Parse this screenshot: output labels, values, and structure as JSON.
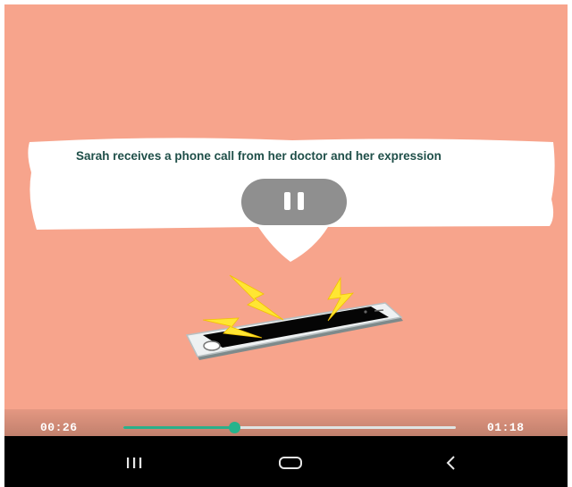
{
  "caption": {
    "text": "Sarah receives a phone call from her doctor and her expression"
  },
  "player": {
    "current_time": "00:26",
    "duration": "01:18",
    "progress": 0.333,
    "state": "playing",
    "pause_icon": "pause-icon"
  },
  "navbar": {
    "recents_icon": "recents-icon",
    "home_icon": "home-icon",
    "back_icon": "back-icon"
  },
  "colors": {
    "background": "#f7a48c",
    "caption_text": "#1f4f49",
    "progress_accent": "#2bb08a",
    "navbar": "#000000"
  }
}
